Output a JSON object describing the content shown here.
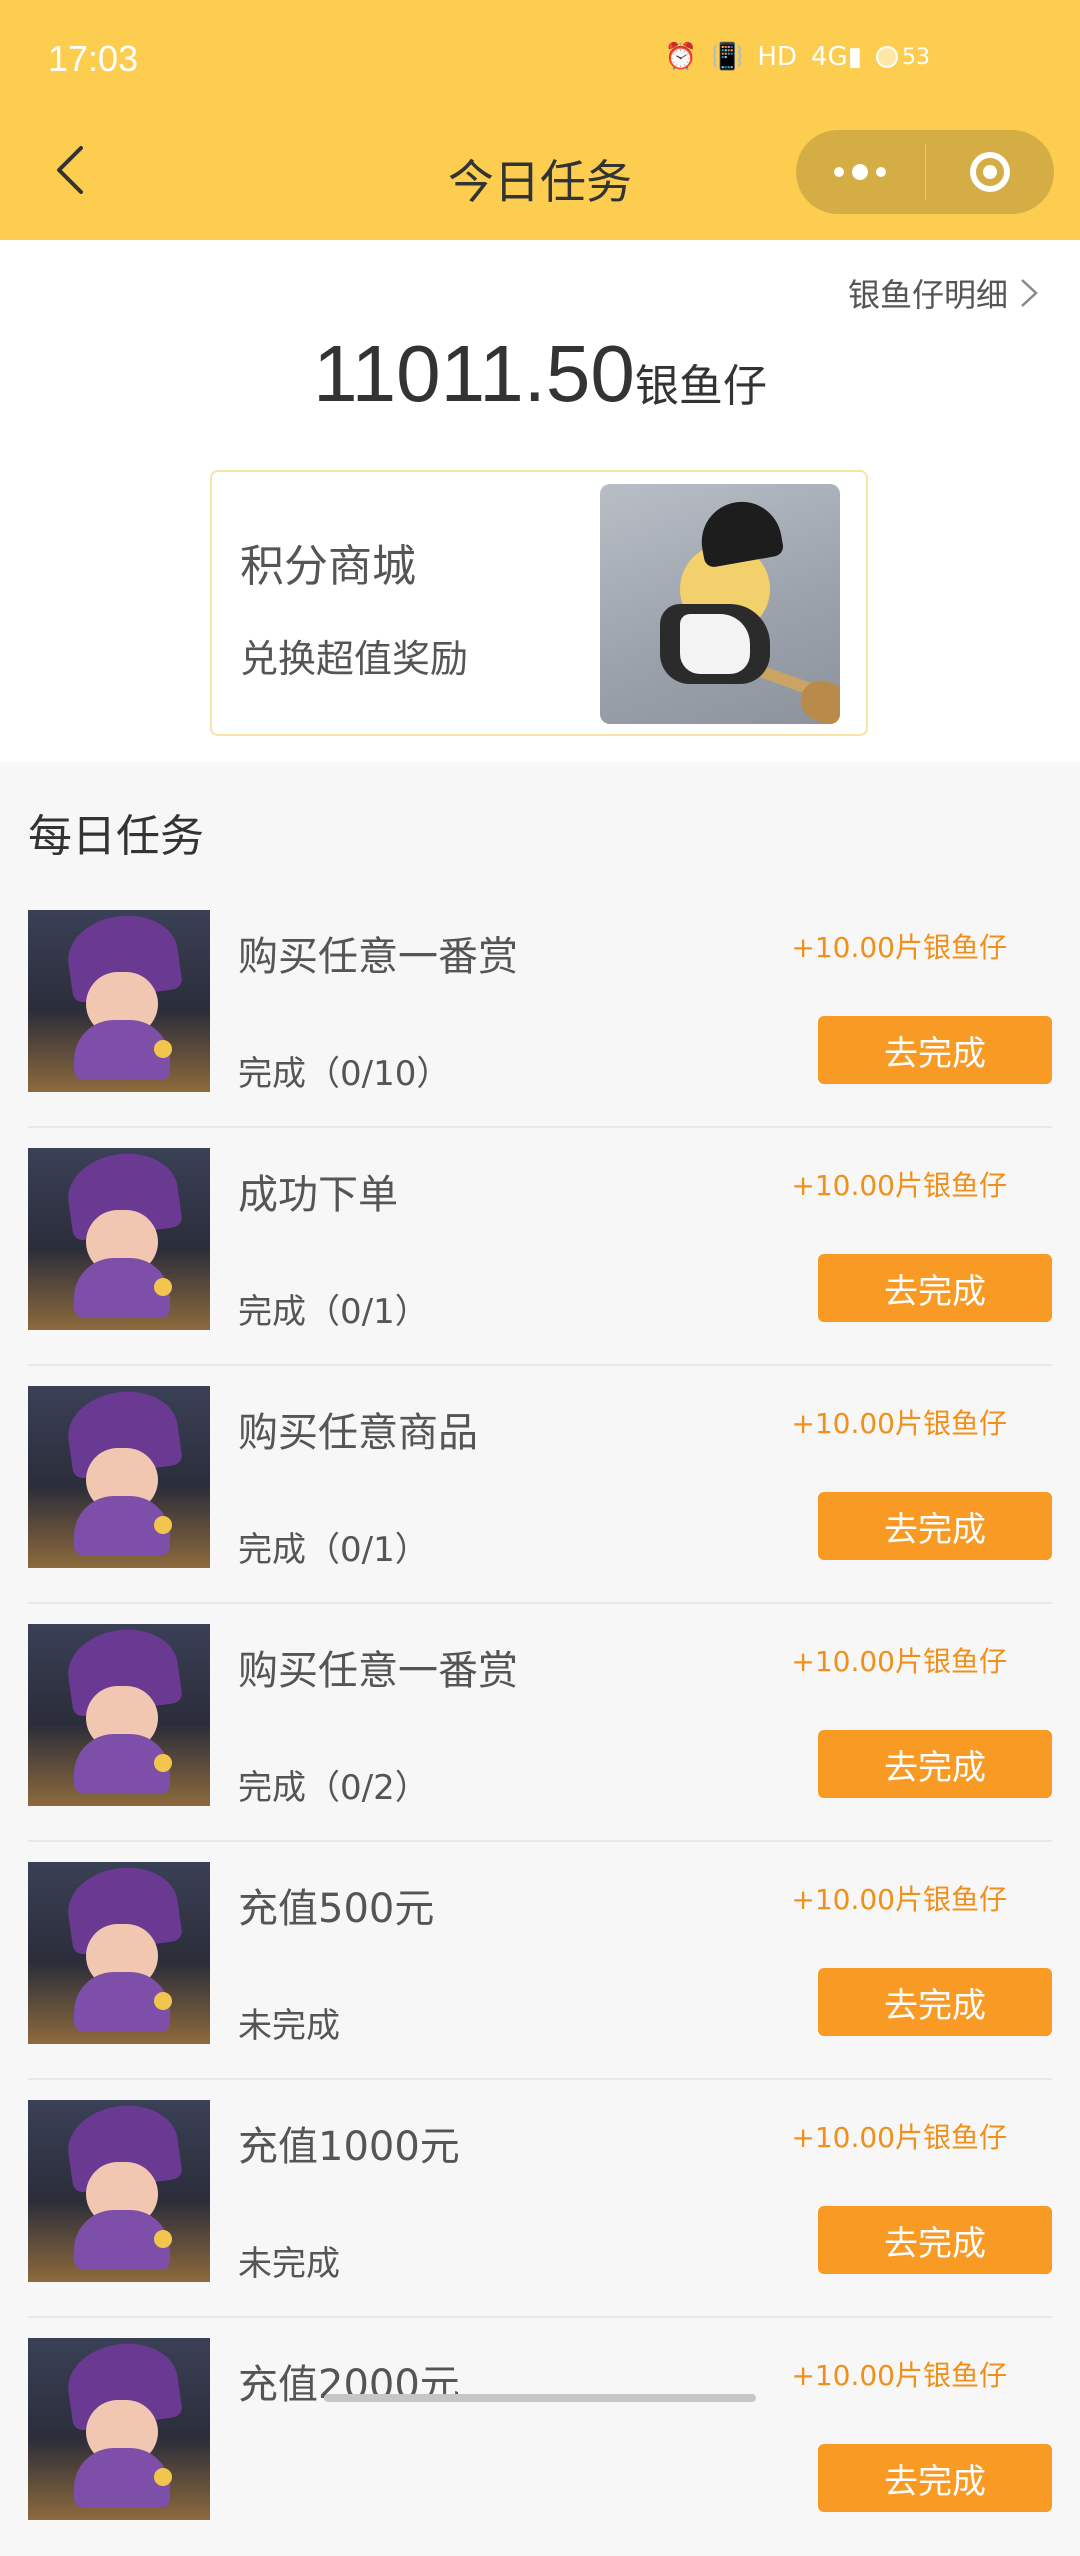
{
  "status_bar": {
    "time": "17:03",
    "icons": [
      "alarm-icon",
      "vibrate-icon",
      "hd-icon",
      "signal-4g-icon"
    ],
    "battery": "53"
  },
  "header": {
    "title": "今日任务",
    "back_icon": "chevron-left-icon",
    "more_icon": "more-dots-icon",
    "close_icon": "target-icon"
  },
  "account": {
    "detail_link": "银鱼仔明细",
    "balance": "11011.50",
    "unit": "银鱼仔"
  },
  "mall": {
    "title": "积分商城",
    "subtitle": "兑换超值奖励"
  },
  "daily": {
    "title": "每日任务",
    "tasks": [
      {
        "name": "购买任意一番赏",
        "progress": "完成（0/10）",
        "reward": "+10.00片银鱼仔",
        "button": "去完成"
      },
      {
        "name": "成功下单",
        "progress": "完成（0/1）",
        "reward": "+10.00片银鱼仔",
        "button": "去完成"
      },
      {
        "name": "购买任意商品",
        "progress": "完成（0/1）",
        "reward": "+10.00片银鱼仔",
        "button": "去完成"
      },
      {
        "name": "购买任意一番赏",
        "progress": "完成（0/2）",
        "reward": "+10.00片银鱼仔",
        "button": "去完成"
      },
      {
        "name": "充值500元",
        "progress": "未完成",
        "reward": "+10.00片银鱼仔",
        "button": "去完成"
      },
      {
        "name": "充值1000元",
        "progress": "未完成",
        "reward": "+10.00片银鱼仔",
        "button": "去完成"
      },
      {
        "name": "充值2000元",
        "progress": "",
        "reward": "+10.00片银鱼仔",
        "button": "去完成"
      }
    ]
  },
  "colors": {
    "header": "#fccd4f",
    "button": "#f99a24",
    "reward": "#f0901b"
  }
}
